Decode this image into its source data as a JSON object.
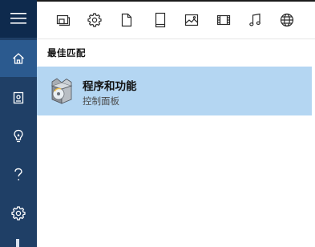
{
  "rail": {
    "items": [
      {
        "name": "menu",
        "icon": "hamburger-icon"
      },
      {
        "name": "home",
        "icon": "home-icon",
        "active": true
      },
      {
        "name": "notebook",
        "icon": "notebook-icon"
      },
      {
        "name": "tips",
        "icon": "lightbulb-icon"
      },
      {
        "name": "help",
        "icon": "question-icon"
      },
      {
        "name": "settings",
        "icon": "gear-icon"
      }
    ]
  },
  "filters": [
    {
      "name": "apps",
      "icon": "app-window-icon"
    },
    {
      "name": "settings",
      "icon": "gear-icon"
    },
    {
      "name": "documents",
      "icon": "document-icon"
    },
    {
      "name": "tablet",
      "icon": "tablet-icon"
    },
    {
      "name": "photos",
      "icon": "picture-icon"
    },
    {
      "name": "videos",
      "icon": "film-icon"
    },
    {
      "name": "music",
      "icon": "music-note-icon"
    },
    {
      "name": "web",
      "icon": "globe-icon"
    }
  ],
  "results": {
    "section_label": "最佳匹配",
    "best_match": {
      "title": "程序和功能",
      "subtitle": "控制面板",
      "icon": "programs-and-features-icon"
    }
  },
  "colors": {
    "rail": "#1f3f66",
    "rail_top": "#0e2a4d",
    "rail_active": "#2b5a8f",
    "highlight": "#b4d6f2"
  }
}
